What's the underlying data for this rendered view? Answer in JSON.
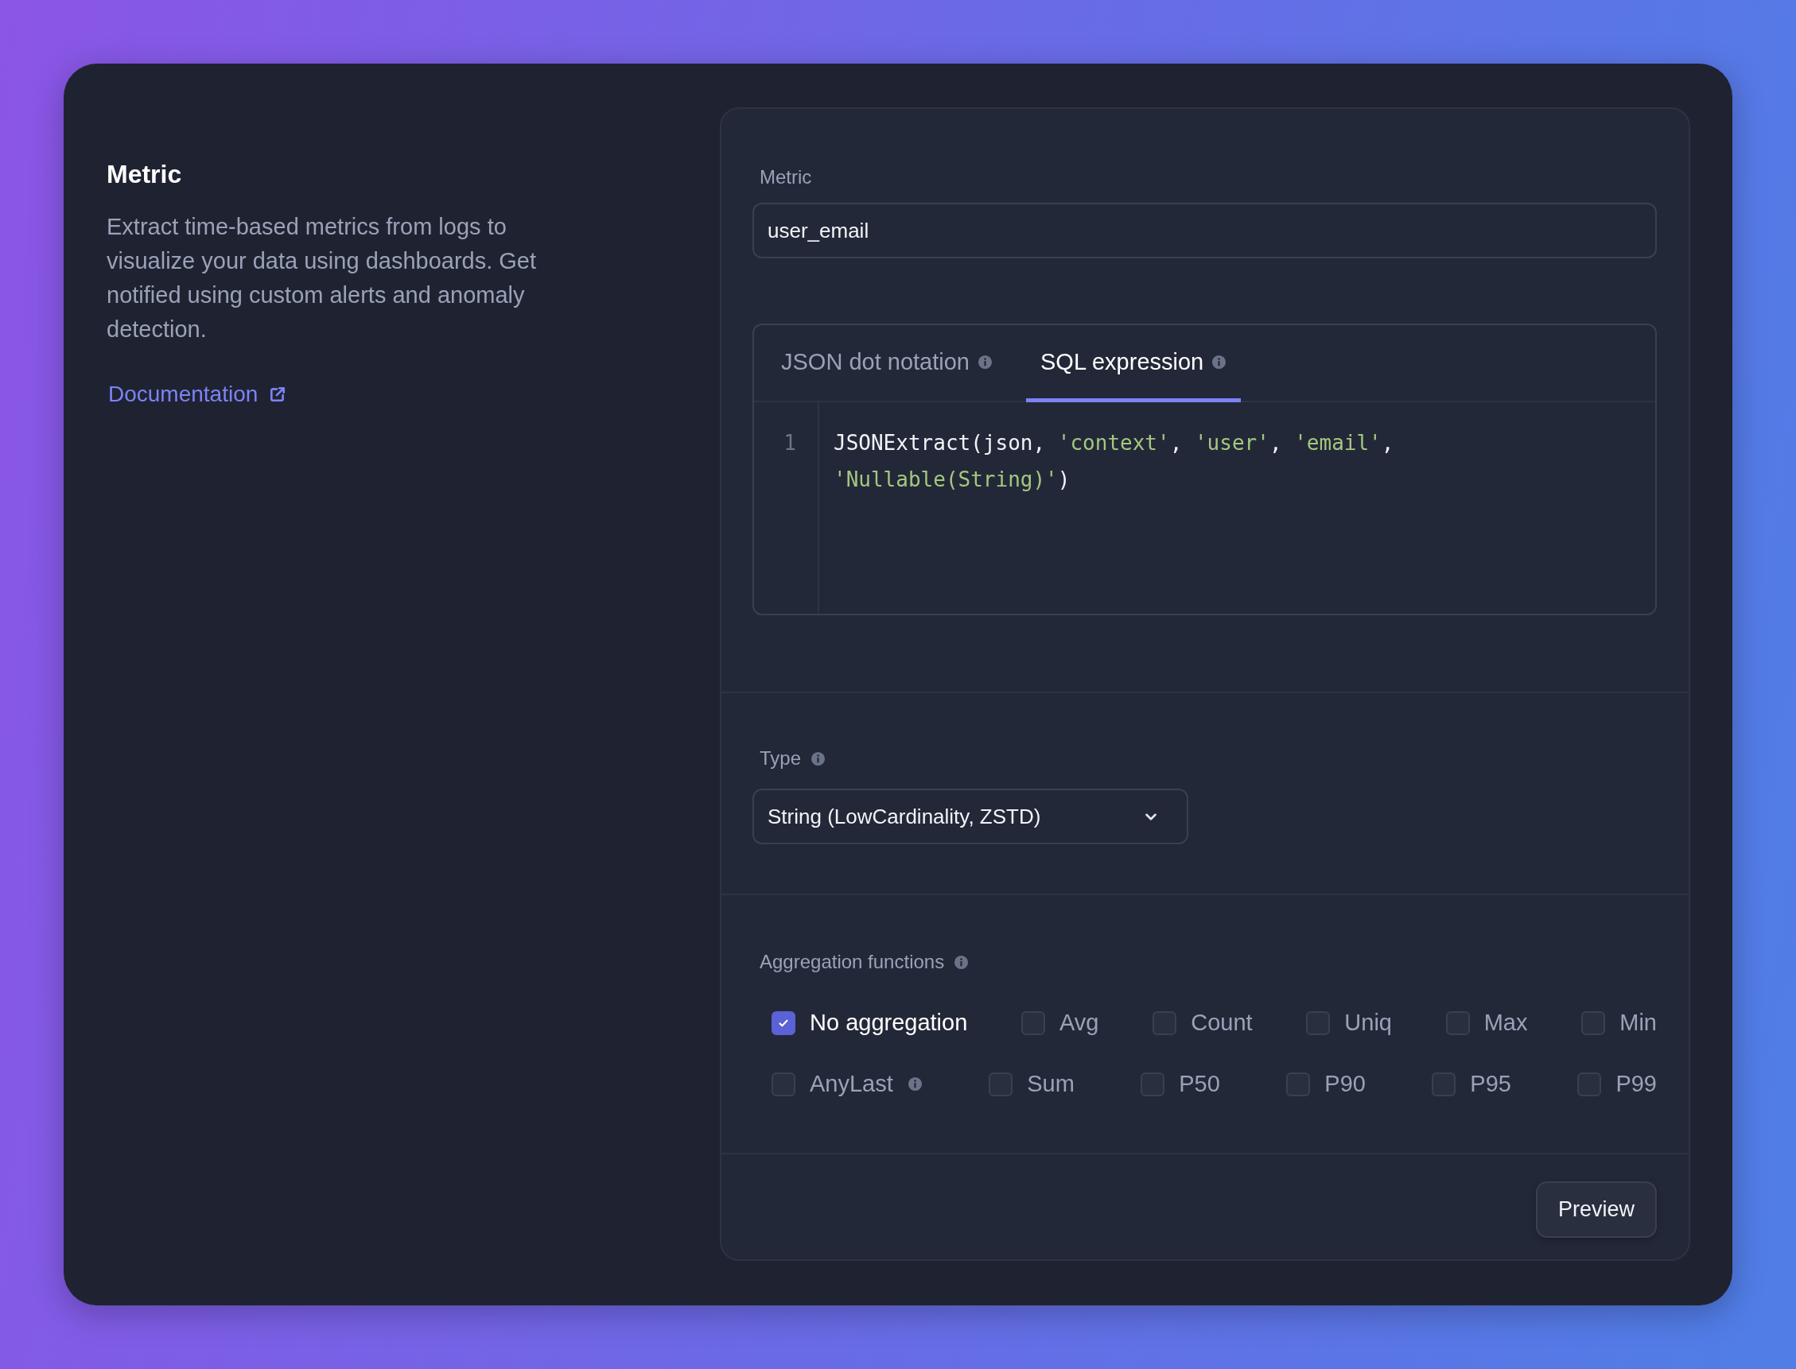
{
  "intro": {
    "title": "Metric",
    "description": "Extract time-based metrics from logs to visualize your data using dashboards. Get notified using custom alerts and anomaly detection.",
    "link": "Documentation"
  },
  "metric_field": {
    "label": "Metric",
    "value": "user_email"
  },
  "editor": {
    "tabs": [
      {
        "label": "JSON dot notation",
        "selected": false
      },
      {
        "label": "SQL expression",
        "selected": true
      }
    ],
    "lines": [
      {
        "number": "1",
        "tokens": [
          {
            "kind": "plain",
            "text": "JSONExtract(json, "
          },
          {
            "kind": "string",
            "text": "'context'"
          },
          {
            "kind": "plain",
            "text": ", "
          },
          {
            "kind": "string",
            "text": "'user'"
          },
          {
            "kind": "plain",
            "text": ", "
          },
          {
            "kind": "string",
            "text": "'email'"
          },
          {
            "kind": "plain",
            "text": ", "
          },
          {
            "kind": "string",
            "text": "'Nullable(String)'"
          },
          {
            "kind": "plain",
            "text": ")"
          }
        ]
      }
    ]
  },
  "type_field": {
    "label": "Type",
    "value": "String (LowCardinality, ZSTD)"
  },
  "aggregation": {
    "label": "Aggregation functions",
    "rows": [
      {
        "options": [
          {
            "label": "No aggregation",
            "checked": true,
            "info": false
          },
          {
            "label": "Avg",
            "checked": false,
            "info": false
          },
          {
            "label": "Count",
            "checked": false,
            "info": false
          },
          {
            "label": "Uniq",
            "checked": false,
            "info": false
          },
          {
            "label": "Max",
            "checked": false,
            "info": false
          },
          {
            "label": "Min",
            "checked": false,
            "info": false
          }
        ]
      },
      {
        "options": [
          {
            "label": "AnyLast",
            "checked": false,
            "info": true
          },
          {
            "label": "Sum",
            "checked": false,
            "info": false
          },
          {
            "label": "P50",
            "checked": false,
            "info": false
          },
          {
            "label": "P90",
            "checked": false,
            "info": false
          },
          {
            "label": "P95",
            "checked": false,
            "info": false
          },
          {
            "label": "P99",
            "checked": false,
            "info": false
          }
        ]
      }
    ]
  },
  "preview_button": "Preview"
}
